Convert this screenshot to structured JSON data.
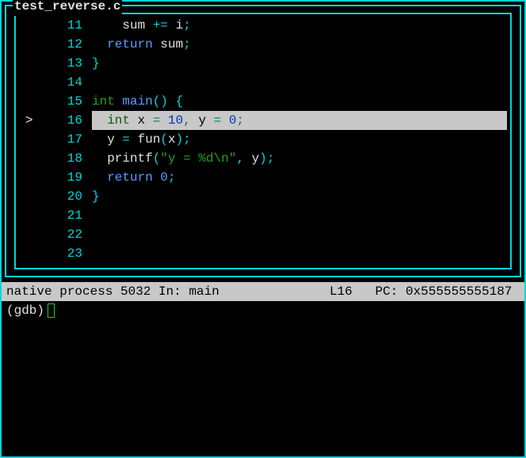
{
  "frame": {
    "title": "test_reverse.c"
  },
  "code": {
    "lines": [
      {
        "num": "11",
        "mark": "",
        "hl": false,
        "tokens": [
          {
            "t": "    ",
            "c": "id"
          },
          {
            "t": "sum ",
            "c": "id"
          },
          {
            "t": "+=",
            "c": "op"
          },
          {
            "t": " i",
            "c": "id"
          },
          {
            "t": ";",
            "c": "op"
          }
        ]
      },
      {
        "num": "12",
        "mark": "",
        "hl": false,
        "tokens": [
          {
            "t": "  ",
            "c": "id"
          },
          {
            "t": "return",
            "c": "fn"
          },
          {
            "t": " sum",
            "c": "id"
          },
          {
            "t": ";",
            "c": "op"
          }
        ]
      },
      {
        "num": "13",
        "mark": "",
        "hl": false,
        "tokens": [
          {
            "t": "}",
            "c": "op"
          }
        ]
      },
      {
        "num": "14",
        "mark": "",
        "hl": false,
        "tokens": []
      },
      {
        "num": "15",
        "mark": "",
        "hl": false,
        "tokens": [
          {
            "t": "int",
            "c": "kw"
          },
          {
            "t": " ",
            "c": "id"
          },
          {
            "t": "main",
            "c": "fn"
          },
          {
            "t": "()",
            "c": "op"
          },
          {
            "t": " ",
            "c": "id"
          },
          {
            "t": "{",
            "c": "op"
          }
        ]
      },
      {
        "num": "16",
        "mark": ">",
        "hl": true,
        "tokens": [
          {
            "t": "  ",
            "c": "id"
          },
          {
            "t": "int",
            "c": "kw"
          },
          {
            "t": " x ",
            "c": "id"
          },
          {
            "t": "=",
            "c": "op"
          },
          {
            "t": " ",
            "c": "id"
          },
          {
            "t": "10",
            "c": "num"
          },
          {
            "t": ",",
            "c": "op"
          },
          {
            "t": " y ",
            "c": "id"
          },
          {
            "t": "=",
            "c": "op"
          },
          {
            "t": " ",
            "c": "id"
          },
          {
            "t": "0",
            "c": "num"
          },
          {
            "t": ";",
            "c": "op"
          }
        ]
      },
      {
        "num": "17",
        "mark": "",
        "hl": false,
        "tokens": [
          {
            "t": "  y ",
            "c": "id"
          },
          {
            "t": "=",
            "c": "op"
          },
          {
            "t": " fun",
            "c": "id"
          },
          {
            "t": "(",
            "c": "op"
          },
          {
            "t": "x",
            "c": "id"
          },
          {
            "t": ");",
            "c": "op"
          }
        ]
      },
      {
        "num": "18",
        "mark": "",
        "hl": false,
        "tokens": [
          {
            "t": "  printf",
            "c": "id"
          },
          {
            "t": "(",
            "c": "op"
          },
          {
            "t": "\"y = %d\\n\"",
            "c": "str"
          },
          {
            "t": ",",
            "c": "op"
          },
          {
            "t": " y",
            "c": "id"
          },
          {
            "t": ");",
            "c": "op"
          }
        ]
      },
      {
        "num": "19",
        "mark": "",
        "hl": false,
        "tokens": [
          {
            "t": "  ",
            "c": "id"
          },
          {
            "t": "return",
            "c": "fn"
          },
          {
            "t": " ",
            "c": "id"
          },
          {
            "t": "0",
            "c": "num"
          },
          {
            "t": ";",
            "c": "op"
          }
        ]
      },
      {
        "num": "20",
        "mark": "",
        "hl": false,
        "tokens": [
          {
            "t": "}",
            "c": "op"
          }
        ]
      },
      {
        "num": "21",
        "mark": "",
        "hl": false,
        "tokens": []
      },
      {
        "num": "22",
        "mark": "",
        "hl": false,
        "tokens": []
      },
      {
        "num": "23",
        "mark": "",
        "hl": false,
        "tokens": []
      }
    ]
  },
  "status": {
    "left": "native process 5032 In: main",
    "line_label": "L16",
    "pc_label": "PC: 0x555555555187"
  },
  "prompt": {
    "text": "(gdb) "
  }
}
